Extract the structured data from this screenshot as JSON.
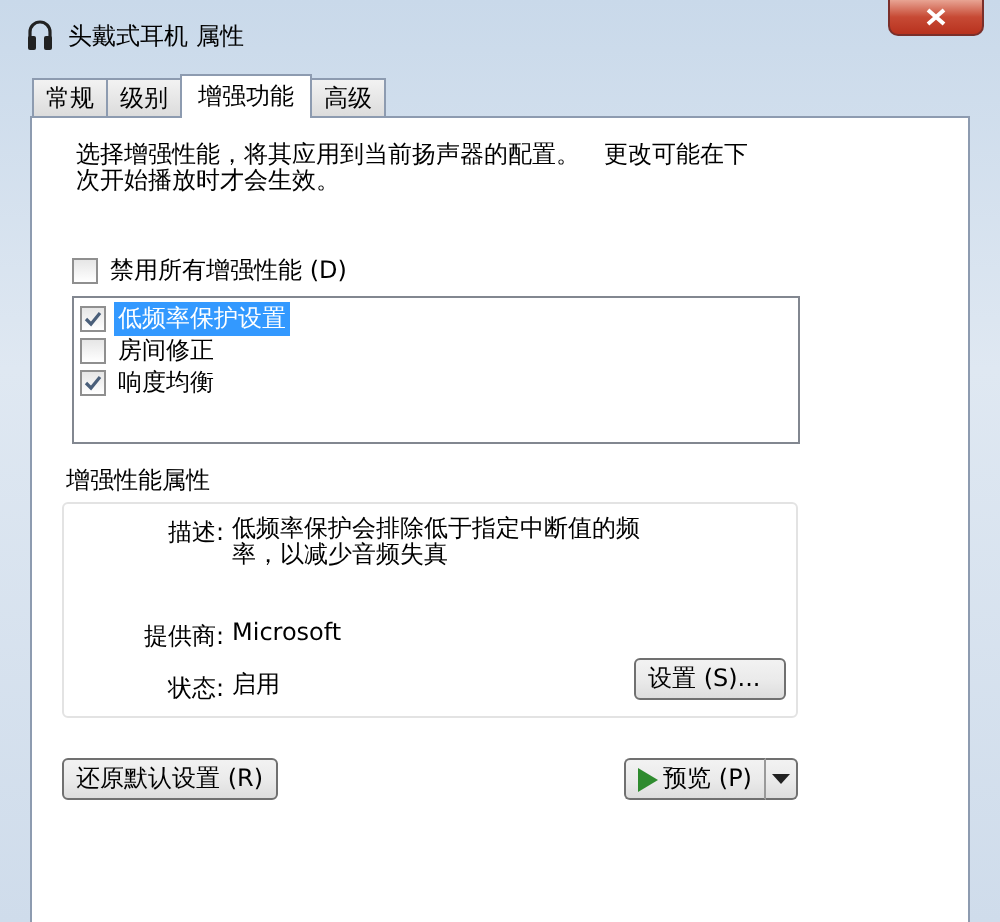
{
  "window": {
    "title": "头戴式耳机 属性"
  },
  "tabs": [
    {
      "label": "常规",
      "selected": false
    },
    {
      "label": "级别",
      "selected": false
    },
    {
      "label": "增强功能",
      "selected": true
    },
    {
      "label": "高级",
      "selected": false
    }
  ],
  "intro": "选择增强性能，将其应用到当前扬声器的配置。　更改可能在下次开始播放时才会生效。",
  "disable_all": {
    "label": "禁用所有增强性能 (D)",
    "checked": false
  },
  "enhancements": [
    {
      "label": "低频率保护设置",
      "checked": true,
      "selected": true
    },
    {
      "label": "房间修正",
      "checked": false,
      "selected": false
    },
    {
      "label": "响度均衡",
      "checked": true,
      "selected": false
    }
  ],
  "properties": {
    "title": "增强性能属性",
    "rows": [
      {
        "label": "描述:",
        "value": "低频率保护会排除低于指定中断值的频率，以减少音频失真"
      },
      {
        "label": "提供商:",
        "value": "Microsoft"
      },
      {
        "label": "状态:",
        "value": "启用"
      }
    ],
    "settings_button": "设置 (S)..."
  },
  "restore_button": "还原默认设置 (R)",
  "preview_button": "预览 (P)"
}
